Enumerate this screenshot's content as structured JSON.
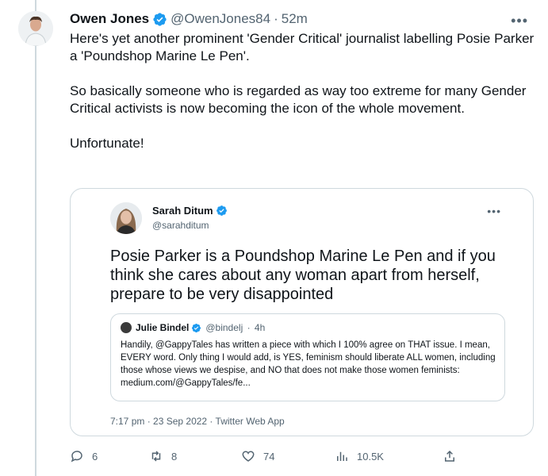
{
  "tweet": {
    "author_name": "Owen Jones",
    "author_handle": "@OwenJones84",
    "time_ago": "52m",
    "paragraphs": [
      "Here's yet another prominent 'Gender Critical' journalist labelling Posie Parker a 'Poundshop Marine Le Pen'.",
      "So basically someone who is regarded as way too extreme for many Gender Critical activists is now becoming the icon of the whole movement.",
      "Unfortunate!"
    ]
  },
  "embedded": {
    "author_name": "Sarah Ditum",
    "author_handle": "@sarahditum",
    "text": "Posie Parker is a Poundshop Marine Le Pen  and if you think she cares about any woman apart from herself, prepare to be very disappointed",
    "quote": {
      "author_name": "Julie Bindel",
      "author_handle": "@bindelj",
      "time_ago": "4h",
      "text": "Handily, @GappyTales has written a piece with which I 100% agree on THAT issue. I mean, EVERY word. Only thing I would add, is YES, feminism should liberate ALL women, including those whose views we despise, and NO that does not make those women feminists: medium.com/@GappyTales/fe..."
    },
    "meta": "7:17 pm · 23 Sep 2022 · Twitter Web App"
  },
  "actions": {
    "replies": "6",
    "retweets": "8",
    "likes": "74",
    "views": "10.5K"
  },
  "colors": {
    "verified": "#1d9bf0",
    "secondary_text": "#536471",
    "border": "#cfd9de"
  }
}
